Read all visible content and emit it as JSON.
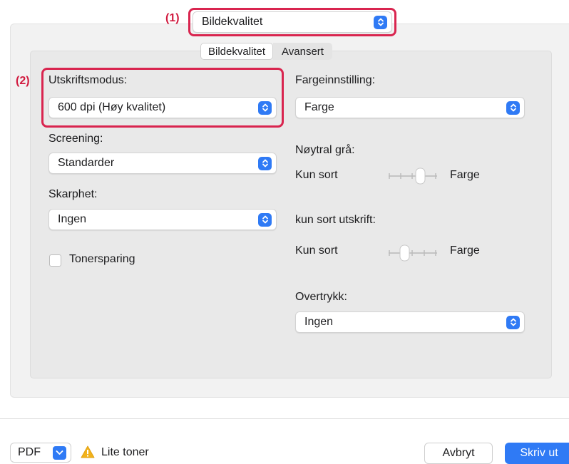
{
  "header": {
    "preset_value": "Bildekvalitet",
    "annotation_1": "(1)",
    "annotation_2": "(2)"
  },
  "tabs": [
    {
      "label": "Bildekvalitet",
      "selected": true
    },
    {
      "label": "Avansert",
      "selected": false
    }
  ],
  "left": {
    "print_mode_label": "Utskriftsmodus:",
    "print_mode_value": "600 dpi (Høy kvalitet)",
    "screening_label": "Screening:",
    "screening_value": "Standarder",
    "sharpness_label": "Skarphet:",
    "sharpness_value": "Ingen",
    "toner_save_label": "Tonersparing",
    "toner_save_checked": false
  },
  "right": {
    "color_setting_label": "Fargeinnstilling:",
    "color_setting_value": "Farge",
    "neutral_gray_label": "Nøytral grå:",
    "neutral_gray_min": "Kun sort",
    "neutral_gray_max": "Farge",
    "black_only_label": "kun sort utskrift:",
    "black_only_min": "Kun sort",
    "black_only_max": "Farge",
    "overprint_label": "Overtrykk:",
    "overprint_value": "Ingen"
  },
  "footer": {
    "pdf_label": "PDF",
    "warning_text": "Lite toner",
    "cancel_label": "Avbryt",
    "print_label": "Skriv ut"
  },
  "colors": {
    "accent": "#2f7af5",
    "highlight": "#d9254f",
    "annotation": "#d11a3f",
    "warning": "#f2b21b"
  },
  "icons": {
    "stepper": "up-down-chevron-icon",
    "warning": "warning-triangle-icon",
    "pdf_menu": "chevron-down-icon"
  }
}
